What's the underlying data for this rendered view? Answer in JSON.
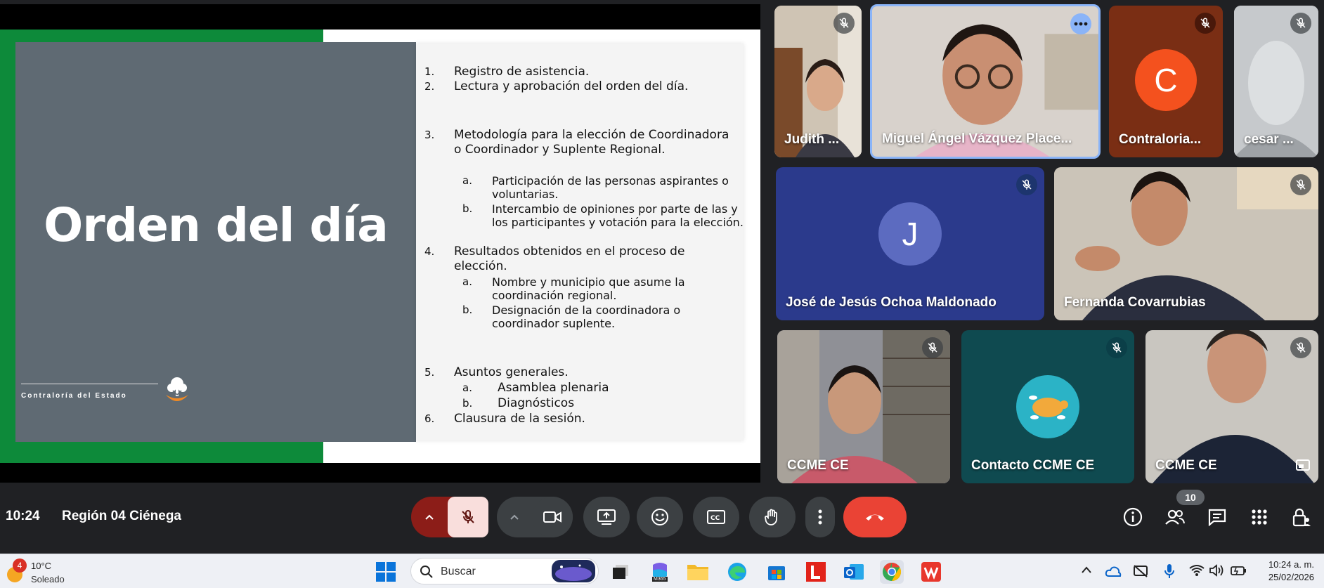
{
  "slide": {
    "title": "Orden del día",
    "logo_text": "Contraloría del Estado",
    "agenda": [
      {
        "num": "1.",
        "text": "Registro de asistencia."
      },
      {
        "num": "2.",
        "text": "Lectura y aprobación del orden del día."
      },
      {
        "num": "3.",
        "text": "Metodología para la elección de Coordinadora o Coordinador y Suplente Regional."
      },
      {
        "num": "a.",
        "text": "Participación de las personas aspirantes o voluntarias."
      },
      {
        "num": "b.",
        "text": "Intercambio de opiniones por parte de las y los participantes y votación para la elección."
      },
      {
        "num": "4.",
        "text": "Resultados obtenidos en el proceso de elección."
      },
      {
        "num": "a.",
        "text": "Nombre y municipio que asume la coordinación regional."
      },
      {
        "num": "b.",
        "text": "Designación de la coordinadora o coordinador suplente."
      },
      {
        "num": "5.",
        "text": "Asuntos generales."
      },
      {
        "num": "a.",
        "text": "Asamblea plenaria"
      },
      {
        "num": "b.",
        "text": "Diagnósticos"
      },
      {
        "num": "6.",
        "text": "Clausura de la sesión."
      }
    ]
  },
  "participants": [
    {
      "name": "Judith ..."
    },
    {
      "name": "Miguel Ángel Vázquez Place..."
    },
    {
      "name": "Contraloria...",
      "initial": "C"
    },
    {
      "name": "cesar ..."
    },
    {
      "name": "José de Jesús Ochoa Maldonado",
      "initial": "J"
    },
    {
      "name": "Fernanda Covarrubias"
    },
    {
      "name": "CCME CE"
    },
    {
      "name": "Contacto CCME CE"
    },
    {
      "name": "CCME CE"
    }
  ],
  "meeting": {
    "time": "10:24",
    "title": "Región 04 Ciénega",
    "participant_count": "10"
  },
  "taskbar": {
    "weather_badge": "4",
    "temperature": "10°C",
    "condition": "Soleado",
    "search_placeholder": "Buscar",
    "time": "10:24 a. m.",
    "date": "25/02/2026",
    "m365_label": "M365"
  },
  "colors": {
    "slide_green": "#0d8a3a",
    "slide_gray": "#5f6a73",
    "end_call": "#ea4335",
    "mic_off_bg": "#f9dedc",
    "accent_blue": "#8ab4f8"
  }
}
